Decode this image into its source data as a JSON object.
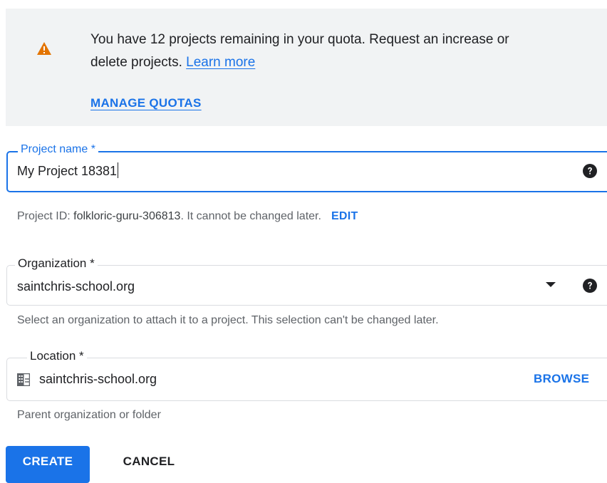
{
  "banner": {
    "icon": "warning-icon",
    "message_line1": "You have 12 projects remaining in your quota. Request an increase or",
    "message_line2": "delete projects.",
    "learn_more": "Learn more",
    "manage_quotas": "MANAGE QUOTAS",
    "icon_color": "#e37400"
  },
  "project_name": {
    "label": "Project name *",
    "value": "My Project 18381",
    "help_icon": "help-icon"
  },
  "project_id": {
    "prefix": "Project ID: ",
    "id": "folkloric-guru-306813",
    "suffix": ". It cannot be changed later.",
    "edit": "EDIT"
  },
  "organization": {
    "label": "Organization *",
    "value": "saintchris-school.org",
    "hint": "Select an organization to attach it to a project. This selection can't be changed later.",
    "help_icon": "help-icon"
  },
  "location": {
    "label": "Location *",
    "value": "saintchris-school.org",
    "icon": "building-icon",
    "browse": "BROWSE",
    "hint": "Parent organization or folder"
  },
  "actions": {
    "create": "CREATE",
    "cancel": "CANCEL"
  },
  "colors": {
    "accent": "#1a73e8",
    "banner_bg": "#f1f3f4"
  }
}
